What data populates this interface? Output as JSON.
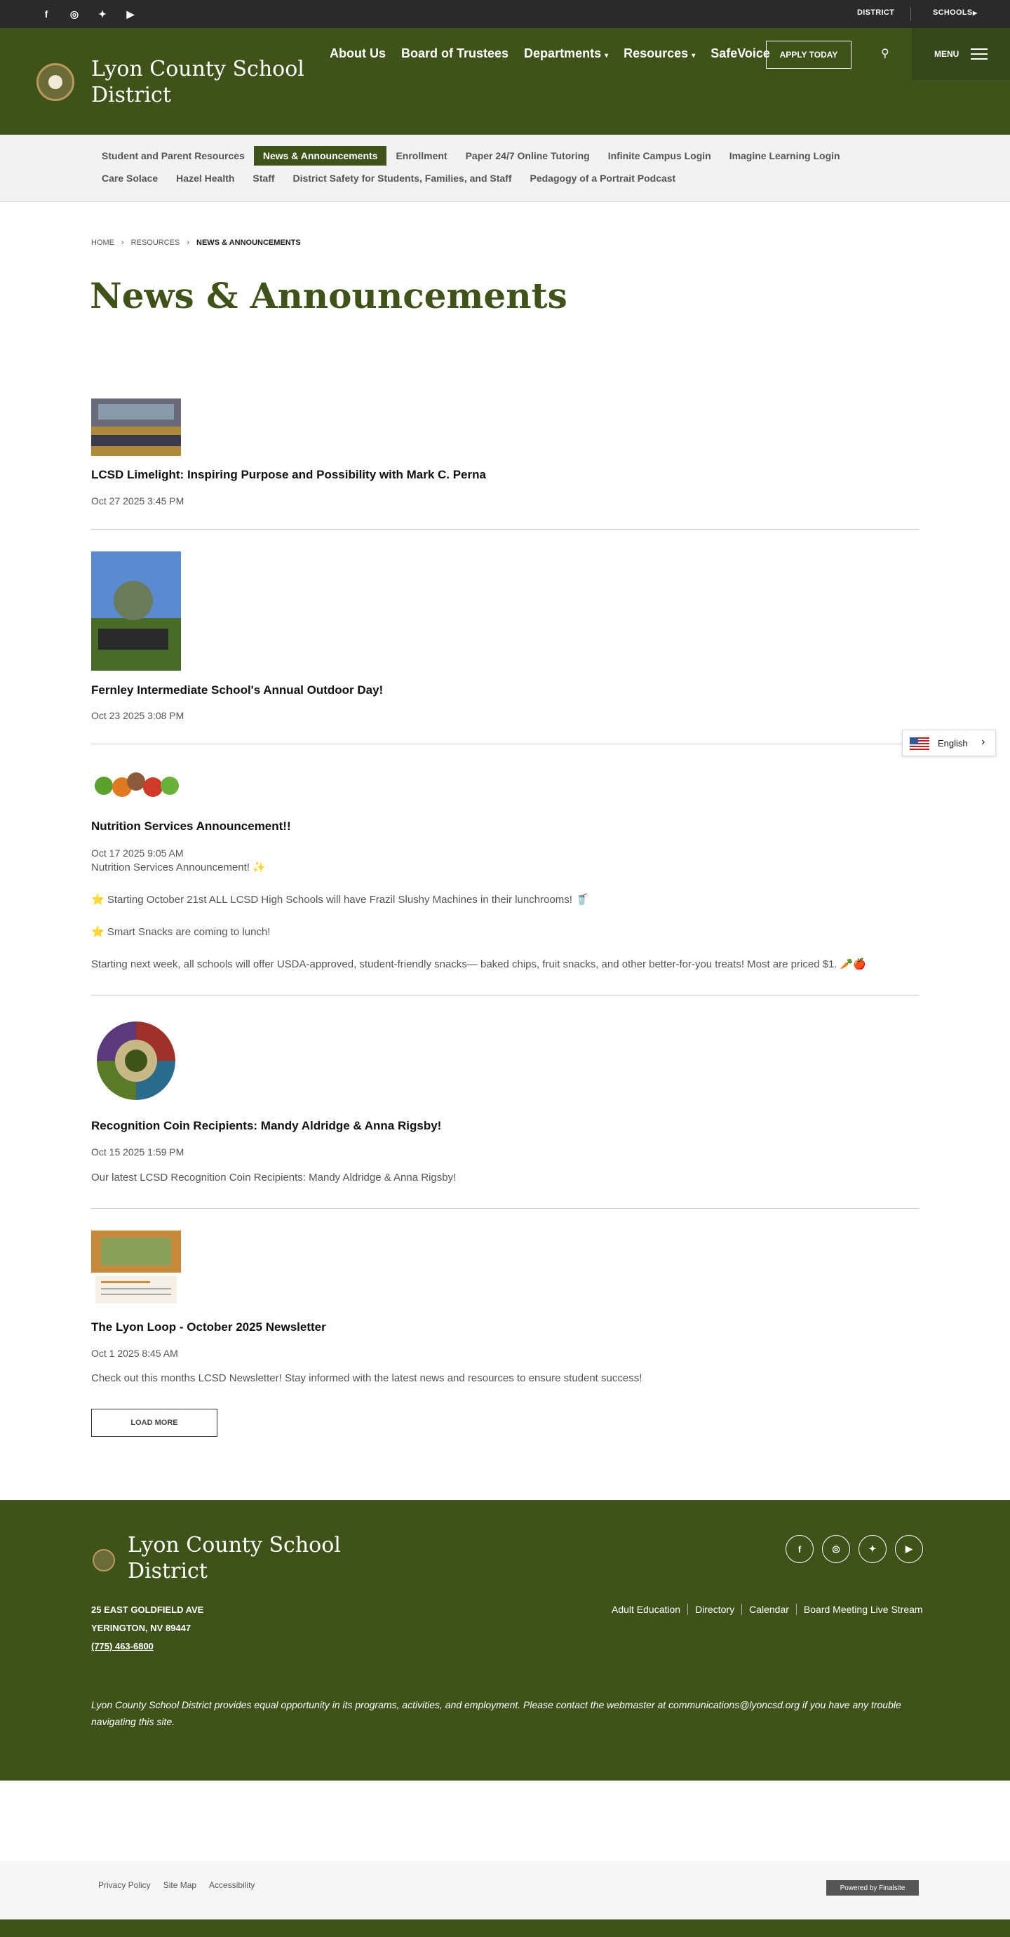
{
  "topbar": {
    "district": "DISTRICT",
    "schools": "SCHOOLS"
  },
  "site": {
    "title": "Lyon County School District"
  },
  "nav": [
    "About Us",
    "Board of Trustees",
    "Departments",
    "Resources",
    "SafeVoice"
  ],
  "apply": "APPLY TODAY",
  "menu": "MENU",
  "subnav_row1": [
    "Student and Parent Resources",
    "News & Announcements",
    "Enrollment",
    "Paper 24/7 Online Tutoring",
    "Infinite Campus Login",
    "Imagine Learning Login"
  ],
  "subnav_row2": [
    "Care Solace",
    "Hazel Health",
    "Staff",
    "District Safety for Students, Families, and Staff",
    "Pedagogy of a Portrait Podcast"
  ],
  "breadcrumb": [
    "HOME",
    "RESOURCES",
    "NEWS & ANNOUNCEMENTS"
  ],
  "page_title": "News & Announcements",
  "items": [
    {
      "title": "LCSD Limelight: Inspiring Purpose and Possibility with Mark C. Perna",
      "date": "Oct 27 2025 3:45 PM"
    },
    {
      "title": "Fernley Intermediate School's Annual Outdoor Day!",
      "date": "Oct 23 2025 3:08 PM"
    },
    {
      "title": "Nutrition Services Announcement!!",
      "date": "Oct 17 2025 9:05 AM",
      "lines": [
        "Nutrition Services Announcement! ✨",
        "⭐ Starting October 21st ALL LCSD High Schools will have Frazil Slushy Machines in their lunchrooms! 🥤",
        "⭐ Smart Snacks are coming to lunch!",
        "Starting next week, all schools will offer USDA-approved, student-friendly snacks— baked chips, fruit snacks, and other better-for-you treats! Most are priced $1. 🥕🍎"
      ]
    },
    {
      "title": "Recognition Coin Recipients: Mandy Aldridge & Anna Rigsby!",
      "date": "Oct 15 2025 1:59 PM",
      "lines": [
        "Our latest LCSD Recognition Coin Recipients: Mandy Aldridge & Anna Rigsby!"
      ]
    },
    {
      "title": "The Lyon Loop - October 2025 Newsletter",
      "date": "Oct 1 2025 8:45 AM",
      "lines": [
        "Check out this months LCSD Newsletter! Stay informed with the latest news and resources to ensure student success!"
      ]
    }
  ],
  "load_more": "LOAD MORE",
  "language": "English",
  "footer": {
    "title": "Lyon County School District",
    "addr1": "25 EAST GOLDFIELD AVE",
    "addr2": "YERINGTON, NV  89447",
    "phone": "(775) 463-6800",
    "links": [
      "Adult Education",
      "Directory",
      "Calendar",
      "Board Meeting Live Stream"
    ],
    "note": "Lyon County School District  provides equal opportunity in its programs, activities, and employment. Please contact the webmaster at communications@lyoncsd.org if you have any trouble navigating this site."
  },
  "bottom_links": [
    "Privacy Policy",
    "Site Map",
    "Accessibility"
  ],
  "powered": "Powered by Finalsite",
  "colors": {
    "brand": "#3e5219",
    "topbar": "#2a2a2a"
  }
}
